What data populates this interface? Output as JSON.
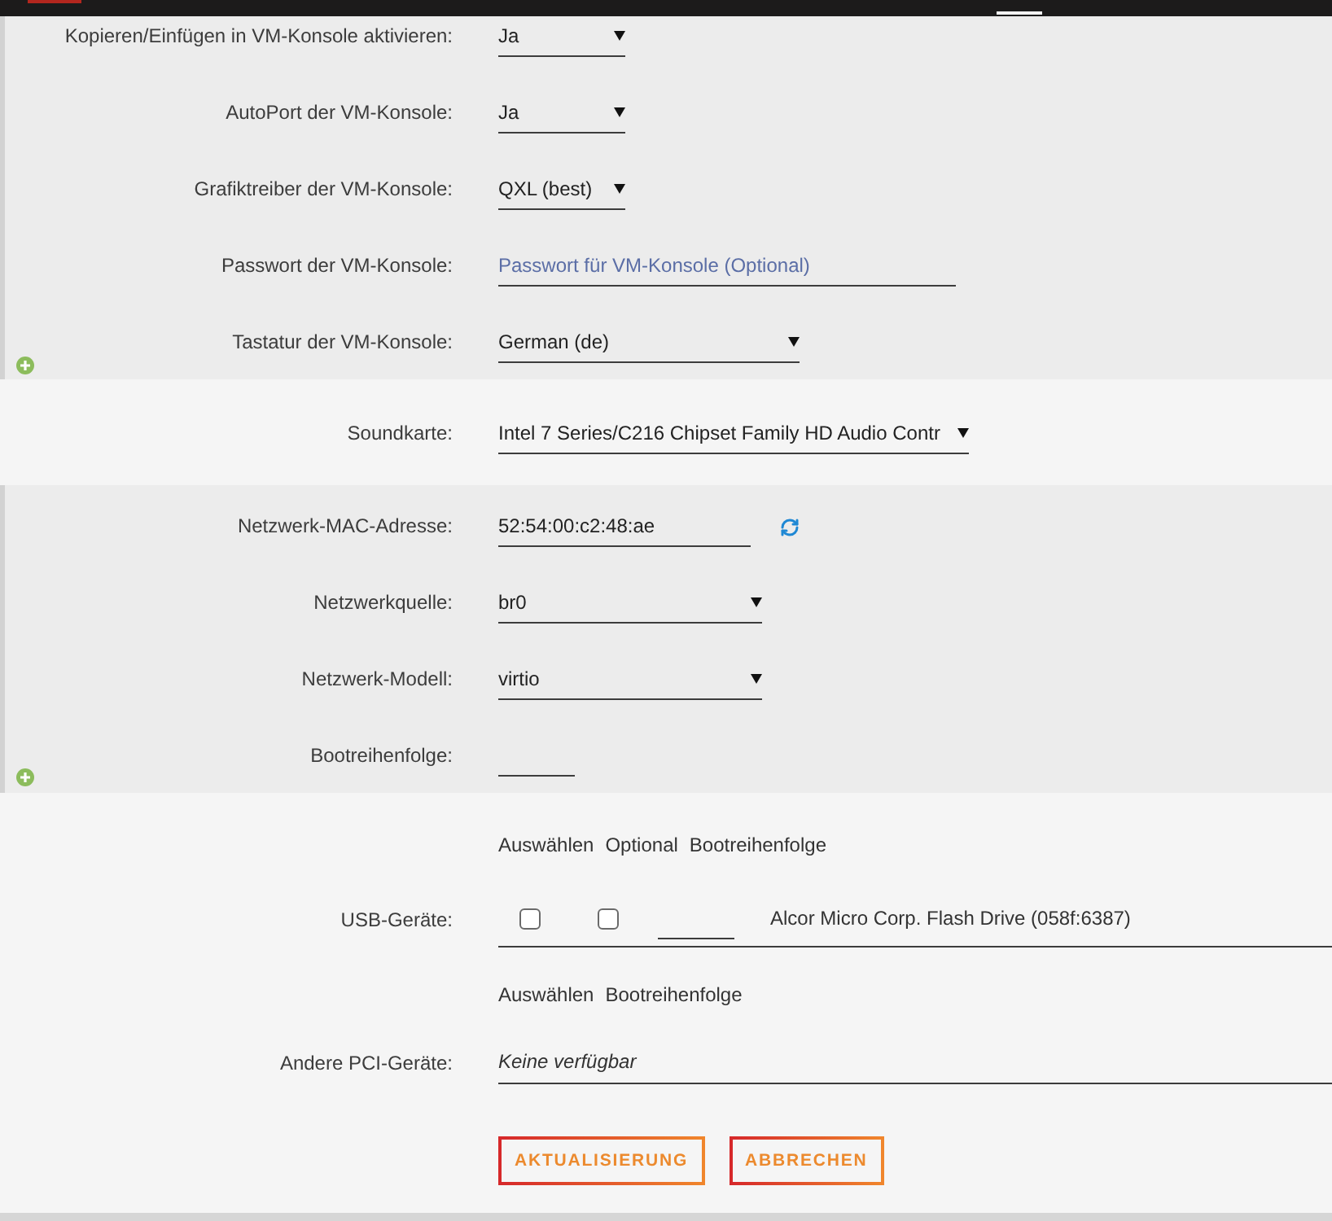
{
  "sections": [
    {
      "add_button": true,
      "fields": [
        {
          "kind": "select",
          "label": "Kopieren/Einfügen in VM-Konsole aktivieren:",
          "value": "Ja"
        },
        {
          "kind": "select",
          "label": "AutoPort der VM-Konsole:",
          "value": "Ja"
        },
        {
          "kind": "select",
          "label": "Grafiktreiber der VM-Konsole:",
          "value": "QXL (best)"
        },
        {
          "kind": "input",
          "label": "Passwort der VM-Konsole:",
          "placeholder": "Passwort für VM-Konsole (Optional)"
        },
        {
          "kind": "select",
          "label": "Tastatur der VM-Konsole:",
          "value": "German (de)"
        }
      ]
    },
    {
      "add_button": false,
      "fields": [
        {
          "kind": "select",
          "label": "Soundkarte:",
          "value": "Intel 7 Series/C216 Chipset Family HD Audio Contr"
        }
      ]
    },
    {
      "add_button": true,
      "fields": [
        {
          "kind": "input",
          "label": "Netzwerk-MAC-Adresse:",
          "value": "52:54:00:c2:48:ae",
          "refresh_button": true
        },
        {
          "kind": "select",
          "label": "Netzwerkquelle:",
          "value": "br0"
        },
        {
          "kind": "select",
          "label": "Netzwerk-Modell:",
          "value": "virtio"
        },
        {
          "kind": "input",
          "label": "Bootreihenfolge:"
        }
      ]
    },
    {
      "add_button": false,
      "fields": [
        {
          "kind": "device_table",
          "label": "USB-Geräte:",
          "columns": [
            "Auswählen",
            "Optional",
            "Bootreihenfolge"
          ],
          "rows": [
            {
              "selected": false,
              "optional": false,
              "name": "Alcor Micro Corp. Flash Drive (058f:6387)"
            }
          ]
        },
        {
          "kind": "device_table",
          "label": "Andere PCI-Geräte:",
          "columns": [
            "Auswählen",
            "Bootreihenfolge"
          ],
          "empty_text": "Keine verfügbar"
        }
      ]
    }
  ],
  "buttons": [
    {
      "label": "AKTUALISIERUNG"
    },
    {
      "label": "ABBRECHEN"
    }
  ]
}
